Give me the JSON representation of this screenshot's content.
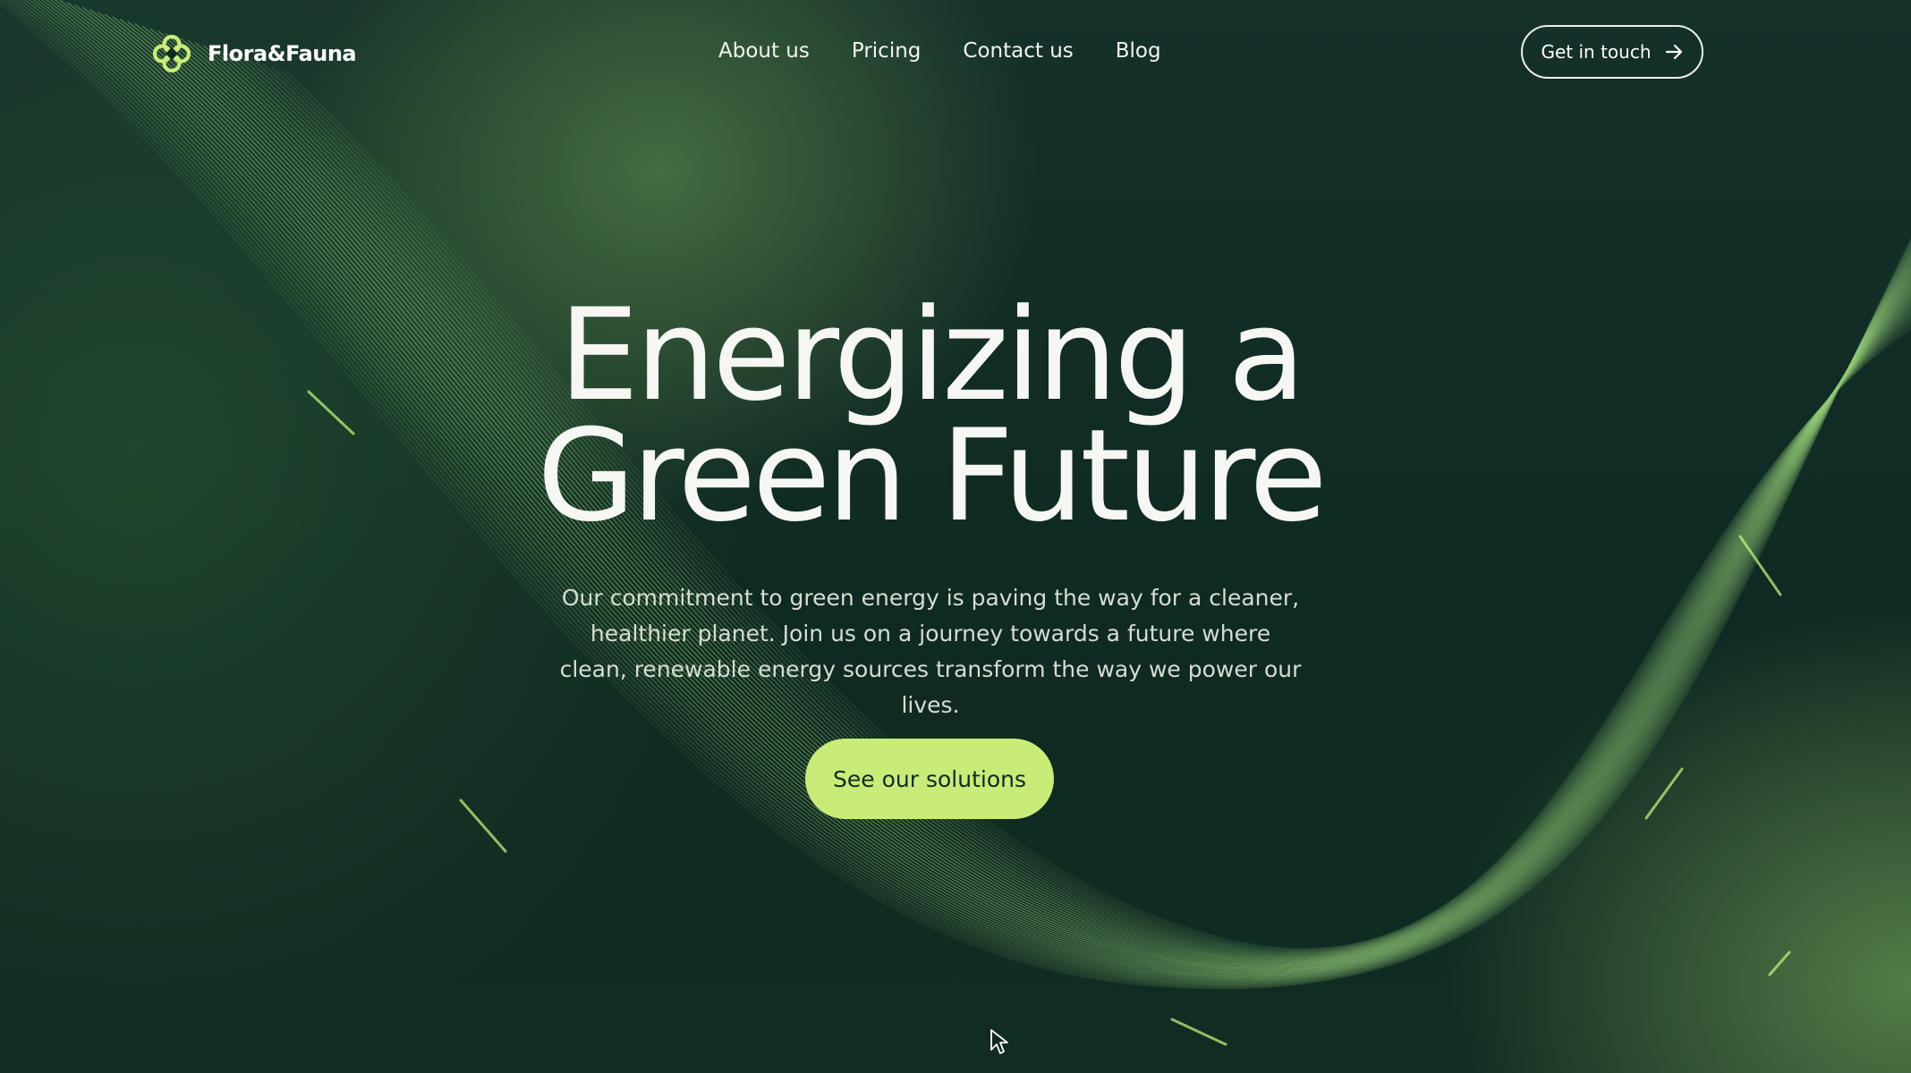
{
  "brand": {
    "name": "Flora&Fauna",
    "logo_icon": "clover-logo-icon",
    "accent_color": "#c9ec78"
  },
  "nav": {
    "links": [
      {
        "label": "About us"
      },
      {
        "label": "Pricing"
      },
      {
        "label": "Contact us"
      },
      {
        "label": "Blog"
      }
    ],
    "cta_label": "Get in touch",
    "cta_icon": "arrow-right-icon"
  },
  "hero": {
    "title_line1": "Energizing a",
    "title_line2": "Green Future",
    "subtitle": "Our commitment to green energy is paving the way for a cleaner, healthier planet. Join us on a journey towards a future where clean, renewable energy sources transform the way we power our lives.",
    "button_label": "See our solutions"
  },
  "colors": {
    "background": "#0f2a22",
    "button": "#c9ec78",
    "button_text": "#122a20",
    "text": "#f6f7f2"
  }
}
